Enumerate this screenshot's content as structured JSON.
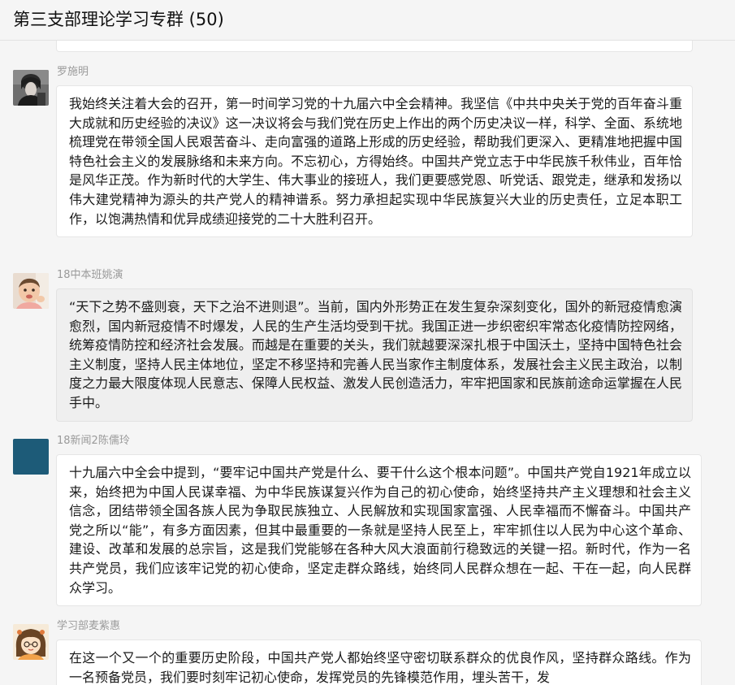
{
  "window": {
    "title": "第三支部理论学习专群 (50)"
  },
  "messages": [
    {
      "sender": "罗施明",
      "avatar_icon": "dark-photo-avatar",
      "text": "我始终关注着大会的召开，第一时间学习党的十九届六中全会精神。我坚信《中共中央关于党的百年奋斗重大成就和历史经验的决议》这一决议将会与我们党在历史上作出的两个历史决议一样，科学、全面、系统地梳理党在带领全国人民艰苦奋斗、走向富强的道路上形成的历史经验，帮助我们更深入、更精准地把握中国特色社会主义的发展脉络和未来方向。不忘初心，方得始终。中国共产党立志于中华民族千秋伟业，百年恰是风华正茂。作为新时代的大学生、伟大事业的接班人，我们更要感党恩、听党话、跟党走，继承和发扬以伟大建党精神为源头的共产党人的精神谱系。努力承担起实现中华民族复兴大业的历史责任，立足本职工作，以饱满热情和优异成绩迎接党的二十大胜利召开。"
    },
    {
      "sender": "18中本班姚演",
      "avatar_icon": "baby-photo-avatar",
      "text": "“天下之势不盛则衰，天下之治不进则退”。当前，国内外形势正在发生复杂深刻变化，国外的新冠疫情愈演愈烈，国内新冠疫情不时爆发，人民的生产生活均受到干扰。我国正进一步织密织牢常态化疫情防控网络，统筹疫情防控和经济社会发展。而越是在重要的关头，我们就越要深深扎根于中国沃土，坚持中国特色社会主义制度，坚持人民主体地位，坚定不移坚持和完善人民当家作主制度体系，发展社会主义民主政治，以制度之力最大限度体现人民意志、保障人民权益、激发人民创造活力，牢牢把国家和民族前途命运掌握在人民手中。"
    },
    {
      "sender": "18新闻2陈儒玲",
      "avatar_icon": "teal-square-avatar",
      "text": "十九届六中全会中提到，“要牢记中国共产党是什么、要干什么这个根本问题”。中国共产党自1921年成立以来，始终把为中国人民谋幸福、为中华民族谋复兴作为自己的初心使命，始终坚持共产主义理想和社会主义信念，团结带领全国各族人民为争取民族独立、人民解放和实现国家富强、人民幸福而不懈奋斗。中国共产党之所以“能”，有多方面因素，但其中最重要的一条就是坚持人民至上，牢牢抓住以人民为中心这个革命、建设、改革和发展的总宗旨，这是我们党能够在各种大风大浪面前行稳致远的关键一招。新时代，作为一名共产党员，我们应该牢记党的初心使命，坚定走群众路线，始终同人民群众想在一起、干在一起，向人民群众学习。"
    },
    {
      "sender": "学习部麦紫惠",
      "avatar_icon": "cartoon-girl-avatar",
      "text": "在这一个又一个的重要历史阶段，中国共产党人都始终坚守密切联系群众的优良作风，坚持群众路线。作为一名预备党员，我们要时刻牢记初心使命，发挥党员的先锋模范作用，埋头苦干，发"
    }
  ]
}
